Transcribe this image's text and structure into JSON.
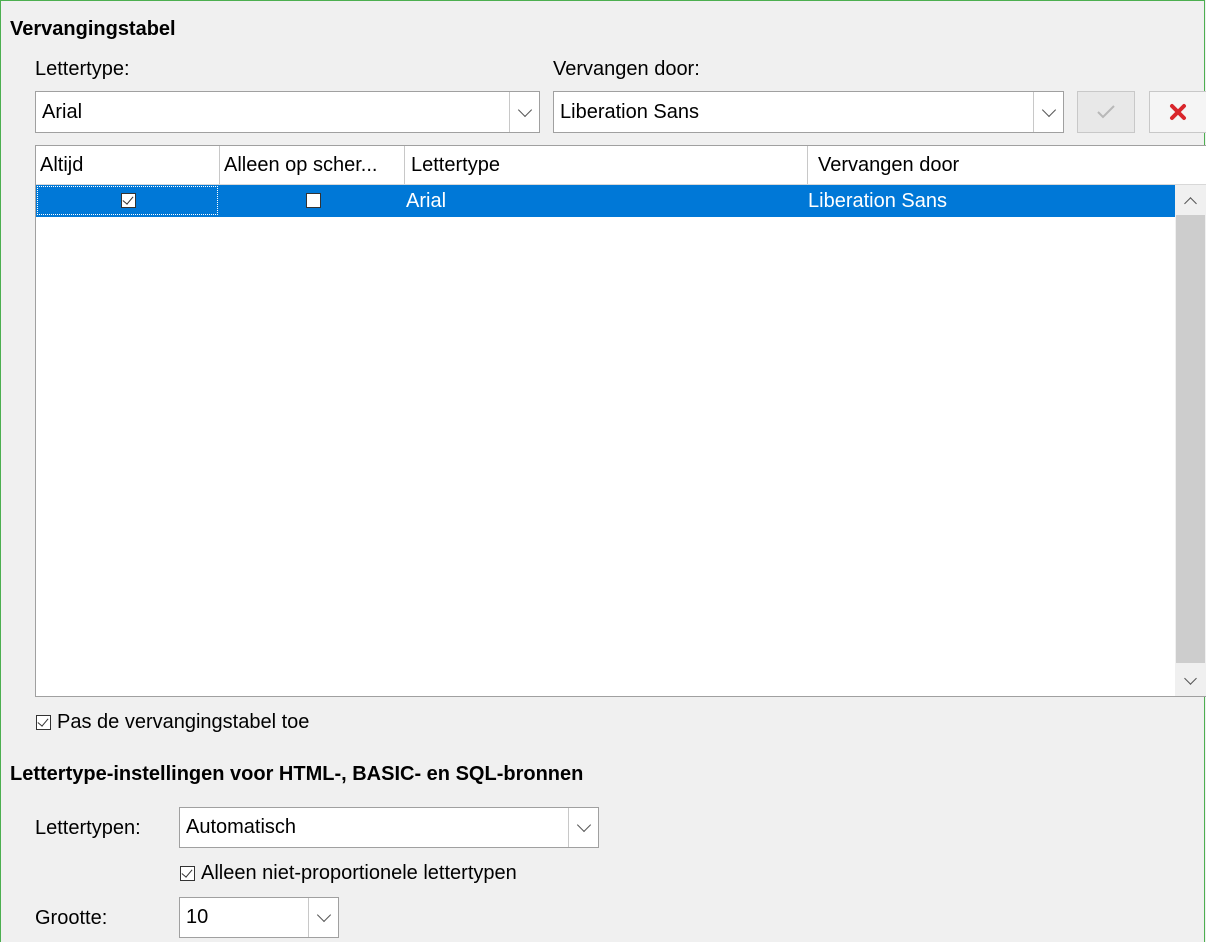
{
  "replacement_table": {
    "heading": "Vervangingstabel",
    "font_label": "Lettertype:",
    "font_value": "Arial",
    "replace_label": "Vervangen door:",
    "replace_value": "Liberation Sans",
    "apply_icon": "checkmark-icon",
    "delete_icon": "delete-x-icon",
    "columns": [
      "Altijd",
      "Alleen op scher...",
      "Lettertype",
      "Vervangen door"
    ],
    "rows": [
      {
        "always": true,
        "screen_only": false,
        "font": "Arial",
        "replace_with": "Liberation Sans"
      }
    ],
    "apply_table_label": "Pas de vervangingstabel toe",
    "apply_table_checked": true
  },
  "source_fonts": {
    "heading": "Lettertype-instellingen voor HTML-, BASIC- en SQL-bronnen",
    "fonts_label": "Lettertypen:",
    "fonts_value": "Automatisch",
    "nonprop_label": "Alleen niet-proportionele lettertypen",
    "nonprop_checked": true,
    "size_label": "Grootte:",
    "size_value": "10"
  },
  "colors": {
    "selection": "#0078d7",
    "delete_red": "#d9262c",
    "frame_green": "#4caf50"
  }
}
